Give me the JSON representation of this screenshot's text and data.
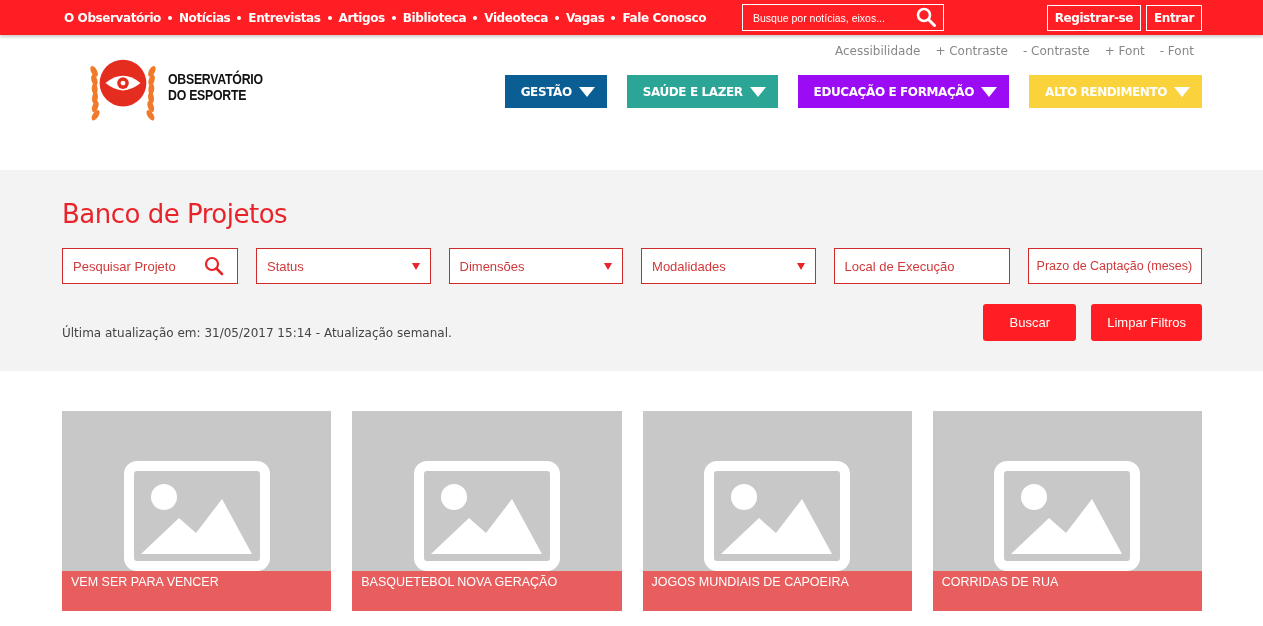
{
  "top_bar": {
    "nav": [
      "O Observatório",
      "Notícias",
      "Entrevistas",
      "Artigos",
      "Biblioteca",
      "Videoteca",
      "Vagas",
      "Fale Conosco"
    ],
    "search": {
      "placeholder": "Busque por notícias, eixos..."
    },
    "buttons": [
      "Registrar-se",
      "Entrar"
    ]
  },
  "header": {
    "logo": {
      "line1": "OBSERVATÓRIO",
      "line2": "DO ESPORTE"
    },
    "accessibility": [
      "Acessibilidade",
      "+ Contraste",
      "- Contraste",
      "+ Font",
      "- Font"
    ],
    "categories": [
      {
        "label": "GESTÃO",
        "color": "#0b5e94"
      },
      {
        "label": "SAÚDE E LAZER",
        "color": "#2aa596"
      },
      {
        "label": "EDUCAÇÃO E FORMAÇÃO",
        "color": "#9b0bf4"
      },
      {
        "label": "ALTO RENDIMENTO",
        "color": "#fad23c"
      }
    ]
  },
  "filters": {
    "title": "Banco de Projetos",
    "fields": [
      {
        "kind": "search",
        "placeholder": "Pesquisar Projeto"
      },
      {
        "kind": "select",
        "label": "Status"
      },
      {
        "kind": "select",
        "label": "Dimensões"
      },
      {
        "kind": "select",
        "label": "Modalidades"
      },
      {
        "kind": "text",
        "placeholder": "Local de Execução"
      },
      {
        "kind": "text",
        "placeholder": "Prazo de Captação (meses)"
      }
    ],
    "updated": "Última atualização em: 31/05/2017 15:14 - Atualização semanal.",
    "buttons": [
      "Buscar",
      "Limpar Filtros"
    ]
  },
  "projects": [
    {
      "title": "VEM SER PARA VENCER"
    },
    {
      "title": "BASQUETEBOL NOVA GERAÇÃO"
    },
    {
      "title": "JOGOS MUNDIAIS DE CAPOEIRA"
    },
    {
      "title": "CORRIDAS DE RUA"
    }
  ]
}
